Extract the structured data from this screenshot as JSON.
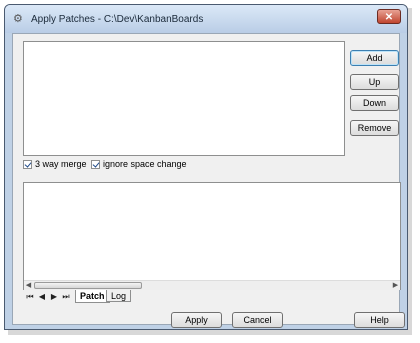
{
  "window": {
    "title": "Apply Patches - C:\\Dev\\KanbanBoards",
    "close_label": "✕"
  },
  "side_buttons": {
    "add": "Add",
    "up": "Up",
    "down": "Down",
    "remove": "Remove"
  },
  "options": {
    "three_way_merge": "3 way merge",
    "ignore_space_change": "ignore space change",
    "three_way_merge_checked": true,
    "ignore_space_change_checked": true
  },
  "tabs": {
    "patch": "Patch",
    "log": "Log",
    "active": "Patch"
  },
  "bottom_buttons": {
    "apply": "Apply",
    "cancel": "Cancel",
    "help": "Help"
  }
}
